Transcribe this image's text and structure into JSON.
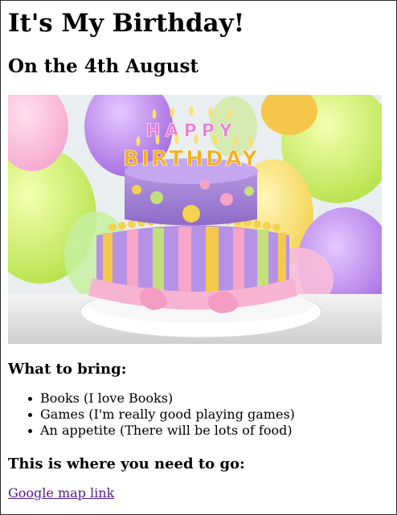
{
  "page": {
    "title": "It's My Birthday!",
    "subtitle": "On the 4th August"
  },
  "hero_image": {
    "cake_topper_line1": "HAPPY",
    "cake_topper_line2": "BIRTHDAY"
  },
  "bring_section": {
    "heading": "What to bring:",
    "items": [
      "Books (I love Books)",
      "Games (I'm really good playing games)",
      "An appetite (There will be lots of food)"
    ]
  },
  "location_section": {
    "heading": "This is where you need to go:",
    "link_text": "Google map link"
  },
  "colors": {
    "link_visited": "#551a8b",
    "text": "#000000",
    "background": "#ffffff"
  }
}
